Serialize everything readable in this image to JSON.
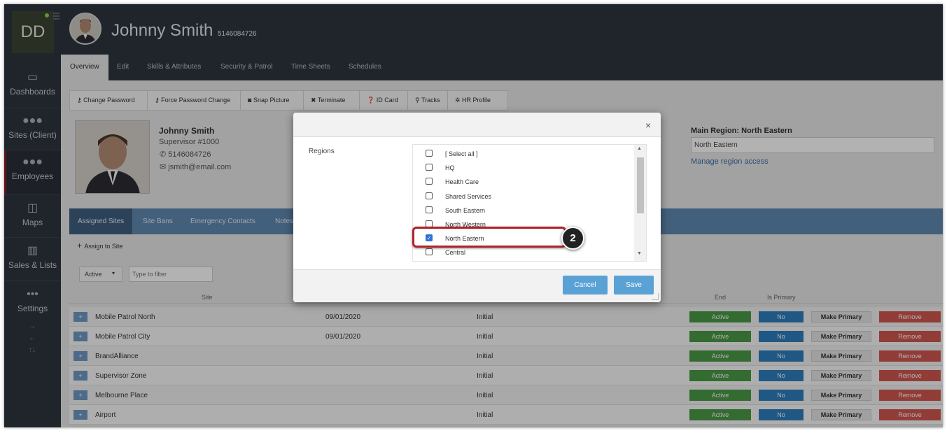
{
  "sidebar": {
    "logo": "DD",
    "items": [
      {
        "icon": "monitor-icon",
        "label": "Dashboards"
      },
      {
        "icon": "group-icon",
        "label": "Sites (Client)"
      },
      {
        "icon": "employees-icon",
        "label": "Employees"
      },
      {
        "icon": "map-icon",
        "label": "Maps"
      },
      {
        "icon": "bar-chart-icon",
        "label": "Sales & Lists"
      },
      {
        "icon": "dots-icon",
        "label": "Settings"
      }
    ],
    "arrows": [
      "→",
      "←",
      "↑↓"
    ]
  },
  "header": {
    "name": "Johnny Smith",
    "phone": "5146084726"
  },
  "tabs": [
    "Overview",
    "Edit",
    "Skills & Attributes",
    "Security & Patrol",
    "Time Sheets",
    "Schedules"
  ],
  "toolbar": [
    "Change Password",
    "Force Password Change",
    "Snap Picture",
    "Terminate",
    "ID Card",
    "Tracks",
    "HR Profile"
  ],
  "profile": {
    "name": "Johnny Smith",
    "role": "Supervisor #1000",
    "phone": "5146084726",
    "email": "jsmith@email.com"
  },
  "region": {
    "title": "Main Region: North Eastern",
    "value": "North Eastern",
    "link": "Manage region access"
  },
  "subtabs": [
    "Assigned Sites",
    "Site Bans",
    "Emergency Contacts",
    "Notes"
  ],
  "assign_label": "Assign to Site",
  "filter": {
    "status": "Active",
    "placeholder": "Type to filter"
  },
  "table": {
    "headers": {
      "site": "Site",
      "end": "End",
      "primary": "Is Primary"
    },
    "rows": [
      {
        "site": "Mobile Patrol North",
        "date": "09/01/2020",
        "status": "Initial",
        "active": "Active",
        "primary": "No",
        "make_primary": "Make Primary",
        "remove": "Remove"
      },
      {
        "site": "Mobile Patrol City",
        "date": "09/01/2020",
        "status": "Initial",
        "active": "Active",
        "primary": "No",
        "make_primary": "Make Primary",
        "remove": "Remove"
      },
      {
        "site": "BrandAlliance",
        "date": "",
        "status": "Initial",
        "active": "Active",
        "primary": "No",
        "make_primary": "Make Primary",
        "remove": "Remove"
      },
      {
        "site": "Supervisor Zone",
        "date": "",
        "status": "Initial",
        "active": "Active",
        "primary": "No",
        "make_primary": "Make Primary",
        "remove": "Remove"
      },
      {
        "site": "Melbourne Place",
        "date": "",
        "status": "Initial",
        "active": "Active",
        "primary": "No",
        "make_primary": "Make Primary",
        "remove": "Remove"
      },
      {
        "site": "Airport",
        "date": "",
        "status": "Initial",
        "active": "Active",
        "primary": "No",
        "make_primary": "Make Primary",
        "remove": "Remove"
      }
    ]
  },
  "modal": {
    "close": "×",
    "label": "Regions",
    "options": [
      {
        "label": "[ Select all ]",
        "checked": false
      },
      {
        "label": "HQ",
        "checked": false
      },
      {
        "label": "Health Care",
        "checked": false
      },
      {
        "label": "Shared Services",
        "checked": false
      },
      {
        "label": "South Eastern",
        "checked": false
      },
      {
        "label": "North Western",
        "checked": false
      },
      {
        "label": "North Eastern",
        "checked": true
      },
      {
        "label": "Central",
        "checked": false
      }
    ],
    "cancel": "Cancel",
    "save": "Save"
  },
  "callout": {
    "number": "2"
  }
}
